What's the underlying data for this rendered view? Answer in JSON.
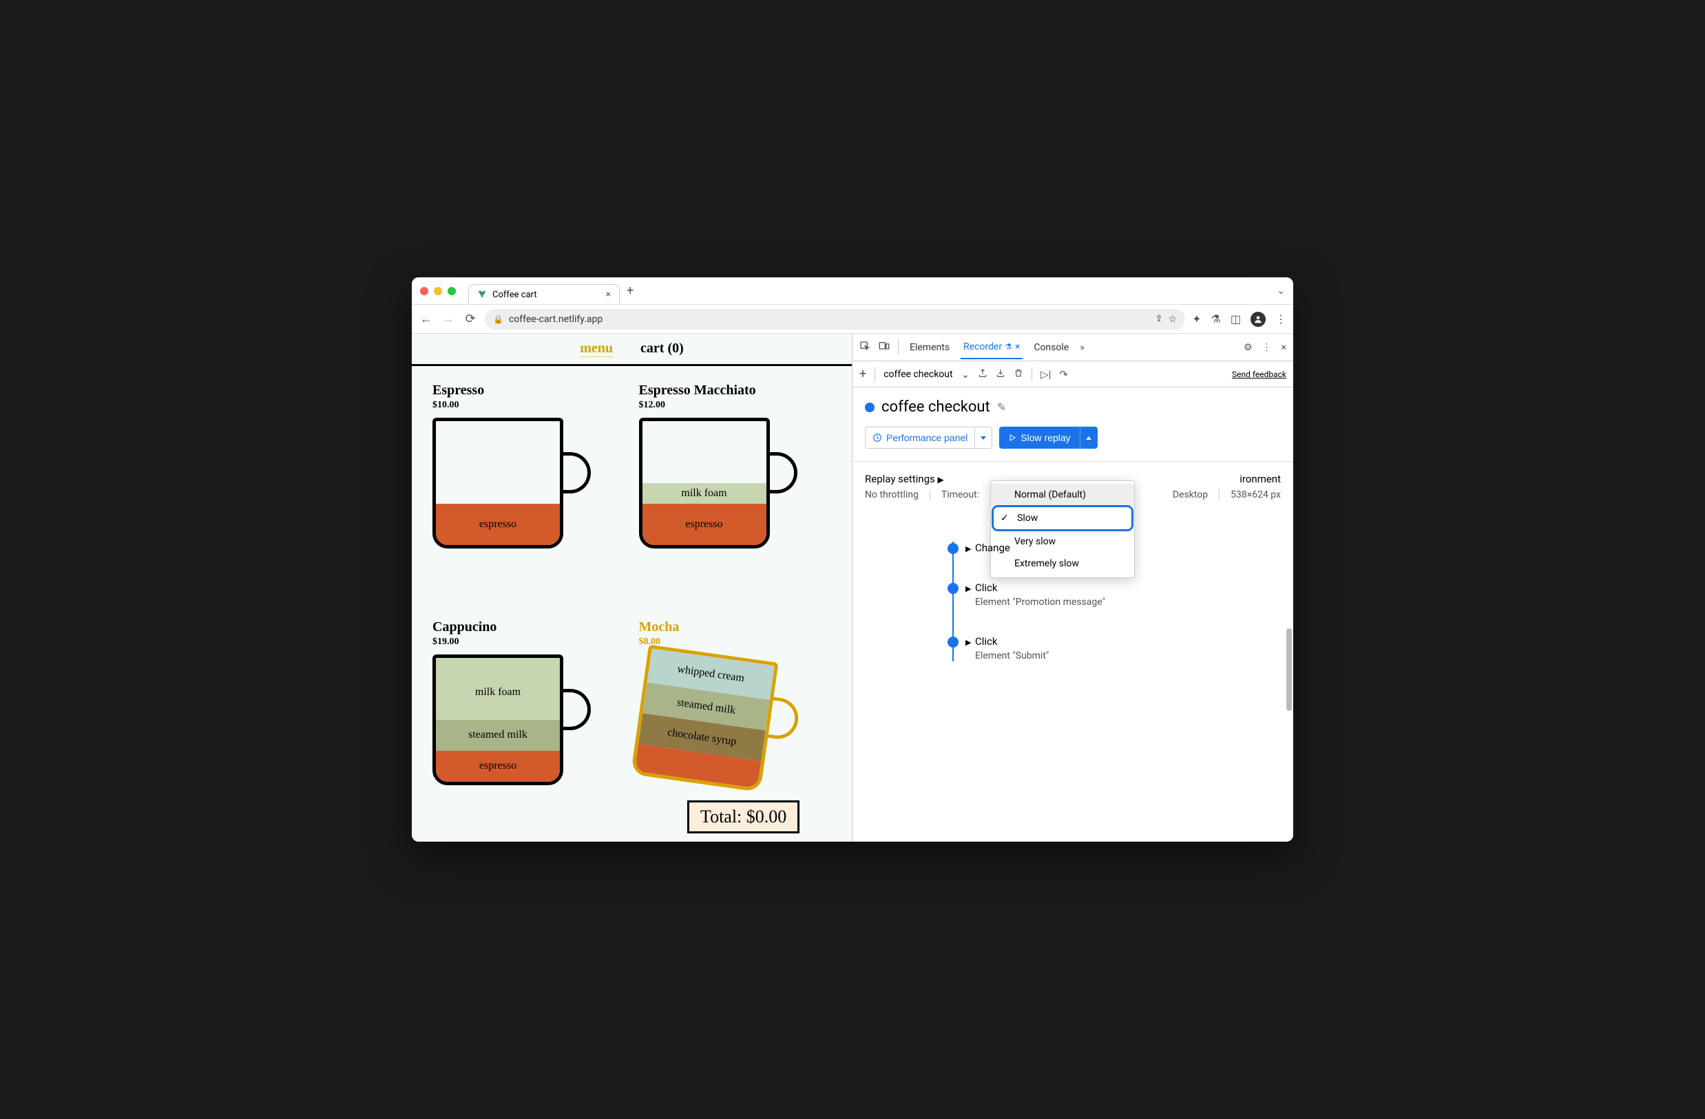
{
  "browser": {
    "tab_title": "Coffee cart",
    "url": "coffee-cart.netlify.app"
  },
  "page": {
    "nav": {
      "menu": "menu",
      "cart": "cart (0)"
    },
    "products": [
      {
        "name": "Espresso",
        "price": "$10.00"
      },
      {
        "name": "Espresso Macchiato",
        "price": "$12.00"
      },
      {
        "name": "Cappucino",
        "price": "$19.00"
      },
      {
        "name": "Mocha",
        "price": "$8.00"
      }
    ],
    "layers": {
      "espresso": "espresso",
      "milkfoam": "milk foam",
      "steamed": "steamed milk",
      "choco": "chocolate syrup",
      "whip": "whipped cream"
    },
    "total_label": "Total: $0.00"
  },
  "devtools": {
    "tabs": {
      "elements": "Elements",
      "recorder": "Recorder",
      "console": "Console"
    },
    "toolbar": {
      "rec_name": "coffee checkout",
      "feedback": "Send feedback"
    },
    "title": "coffee checkout",
    "perf_button": "Performance panel",
    "replay_button": "Slow replay",
    "replay_options": {
      "normal": "Normal (Default)",
      "slow": "Slow",
      "very_slow": "Very slow",
      "extremely_slow": "Extremely slow"
    },
    "settings": {
      "label": "Replay settings",
      "environment": "Environment",
      "no_throttling": "No throttling",
      "timeout": "Timeout:",
      "desktop": "Desktop",
      "viewport": "538×624 px"
    },
    "steps": [
      {
        "title": "Change",
        "sub": ""
      },
      {
        "title": "Click",
        "sub": "Element \"Promotion message\""
      },
      {
        "title": "Click",
        "sub": "Element \"Submit\""
      }
    ]
  },
  "environment_text_truncated": "ironment"
}
